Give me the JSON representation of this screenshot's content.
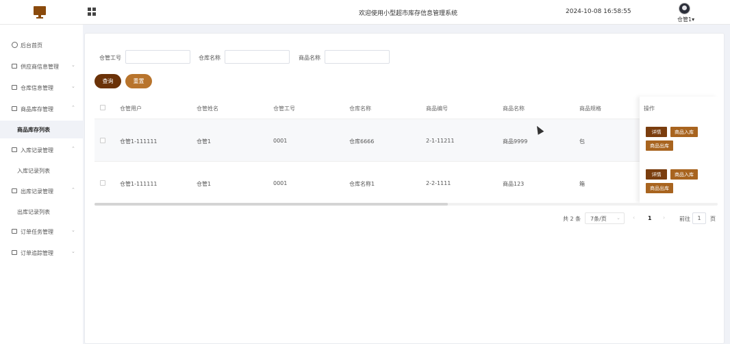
{
  "header": {
    "title": "欢迎使用小型超市库存信息管理系统",
    "datetime": "2024-10-08 16:58:55",
    "user": "仓管1▾"
  },
  "sidebar": {
    "items": [
      {
        "label": "后台首页",
        "icon": "clock-icon"
      },
      {
        "label": "供应商信息管理",
        "icon": "box-icon"
      },
      {
        "label": "仓库信息管理",
        "icon": "box-icon"
      },
      {
        "label": "商品库存管理",
        "icon": "box-icon"
      },
      {
        "label": "商品库存列表",
        "active": true
      },
      {
        "label": "入库记录管理",
        "icon": "box-icon"
      },
      {
        "label": "入库记录列表"
      },
      {
        "label": "出库记录管理",
        "icon": "box-icon"
      },
      {
        "label": "出库记录列表"
      },
      {
        "label": "订单任务管理",
        "icon": "box-icon"
      },
      {
        "label": "订单追踪管理",
        "icon": "box-icon"
      }
    ]
  },
  "filters": {
    "keeper_id_label": "仓管工号",
    "warehouse_name_label": "仓库名称",
    "goods_name_label": "商品名称",
    "keeper_id_value": "",
    "warehouse_name_value": "",
    "goods_name_value": "",
    "query_label": "查询",
    "reset_label": "重置"
  },
  "table": {
    "columns": [
      "仓管用户",
      "仓管姓名",
      "仓管工号",
      "仓库名称",
      "商品编号",
      "商品名称",
      "商品规格",
      "操作"
    ],
    "rows": [
      {
        "user": "仓管1-111111",
        "name": "仓管1",
        "id": "0001",
        "warehouse": "仓库6666",
        "code": "2-1-11211",
        "goods": "商品9999",
        "spec": "包"
      },
      {
        "user": "仓管1-111111",
        "name": "仓管1",
        "id": "0001",
        "warehouse": "仓库名称1",
        "code": "2-2-1111",
        "goods": "商品123",
        "spec": "箱"
      }
    ],
    "actions": {
      "detail": "详情",
      "stock_in": "商品入库",
      "stock_out": "商品出库"
    }
  },
  "pagination": {
    "total": "共 2 条",
    "page_size": "7条/页",
    "current": "1",
    "goto_label": "前往",
    "goto_value": "1",
    "page_suffix": "页"
  },
  "colors": {
    "primary": "#6b3208",
    "secondary": "#b8742c",
    "accent": "#a8641f"
  }
}
